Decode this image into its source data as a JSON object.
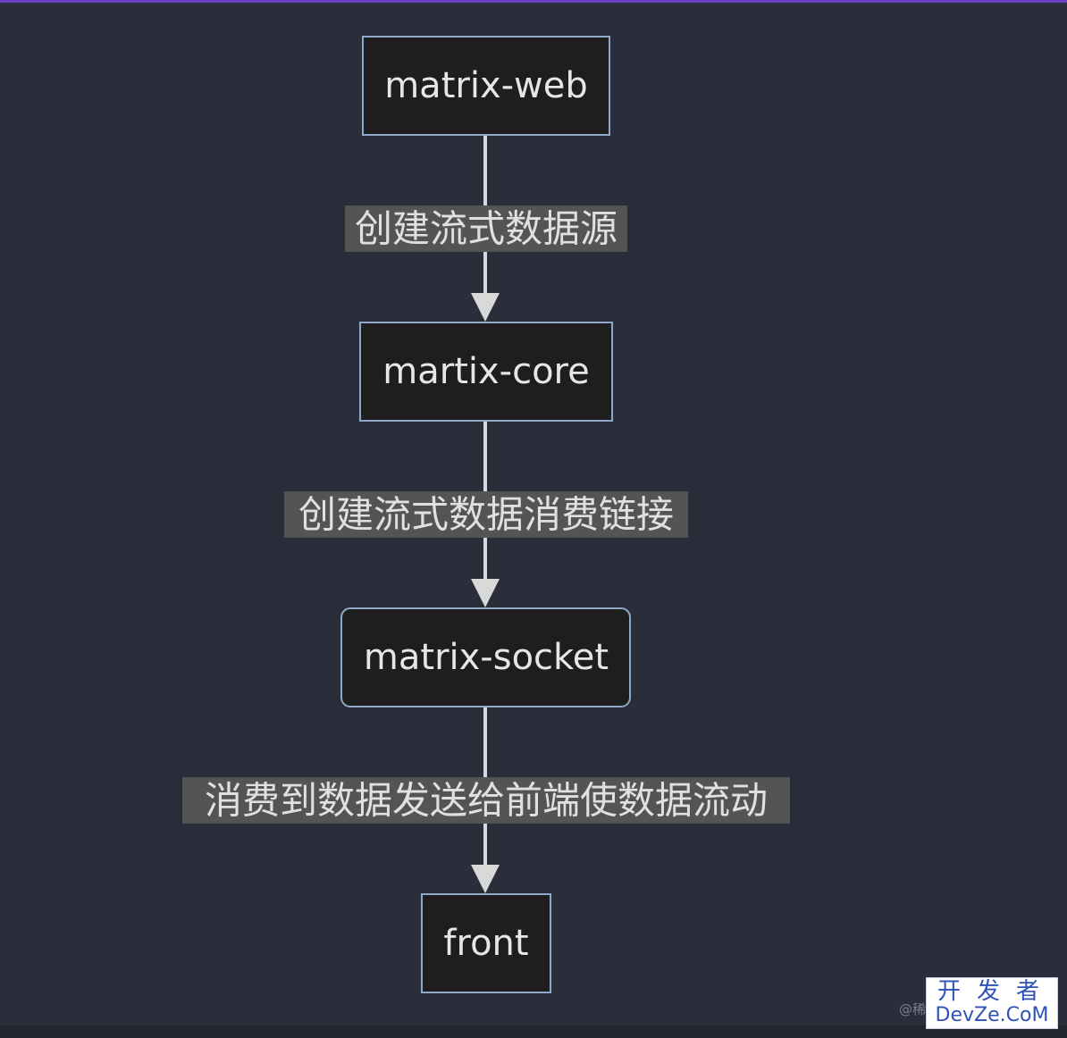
{
  "diagram": {
    "type": "flowchart",
    "direction": "top-down",
    "nodes": [
      {
        "id": "n1",
        "label": "matrix-web",
        "shape": "rect"
      },
      {
        "id": "n2",
        "label": "martix-core",
        "shape": "rect"
      },
      {
        "id": "n3",
        "label": "matrix-socket",
        "shape": "rounded-rect"
      },
      {
        "id": "n4",
        "label": "front",
        "shape": "rect"
      }
    ],
    "edges": [
      {
        "from": "n1",
        "to": "n2",
        "label": "创建流式数据源"
      },
      {
        "from": "n2",
        "to": "n3",
        "label": "创建流式数据消费链接"
      },
      {
        "from": "n3",
        "to": "n4",
        "label": "消费到数据发送给前端使数据流动"
      }
    ]
  },
  "watermark": {
    "prefix": "@稀",
    "line1": "开发者",
    "line2": "DevZe.CoM"
  },
  "colors": {
    "background": "#2a2d3a",
    "node_fill": "#1e1e1e",
    "node_stroke": "#8fa8c8",
    "edge": "#d9d9d9",
    "label_bg": "#545454",
    "watermark_text": "#2f52b8",
    "top_accent": "#6a3fc4"
  }
}
